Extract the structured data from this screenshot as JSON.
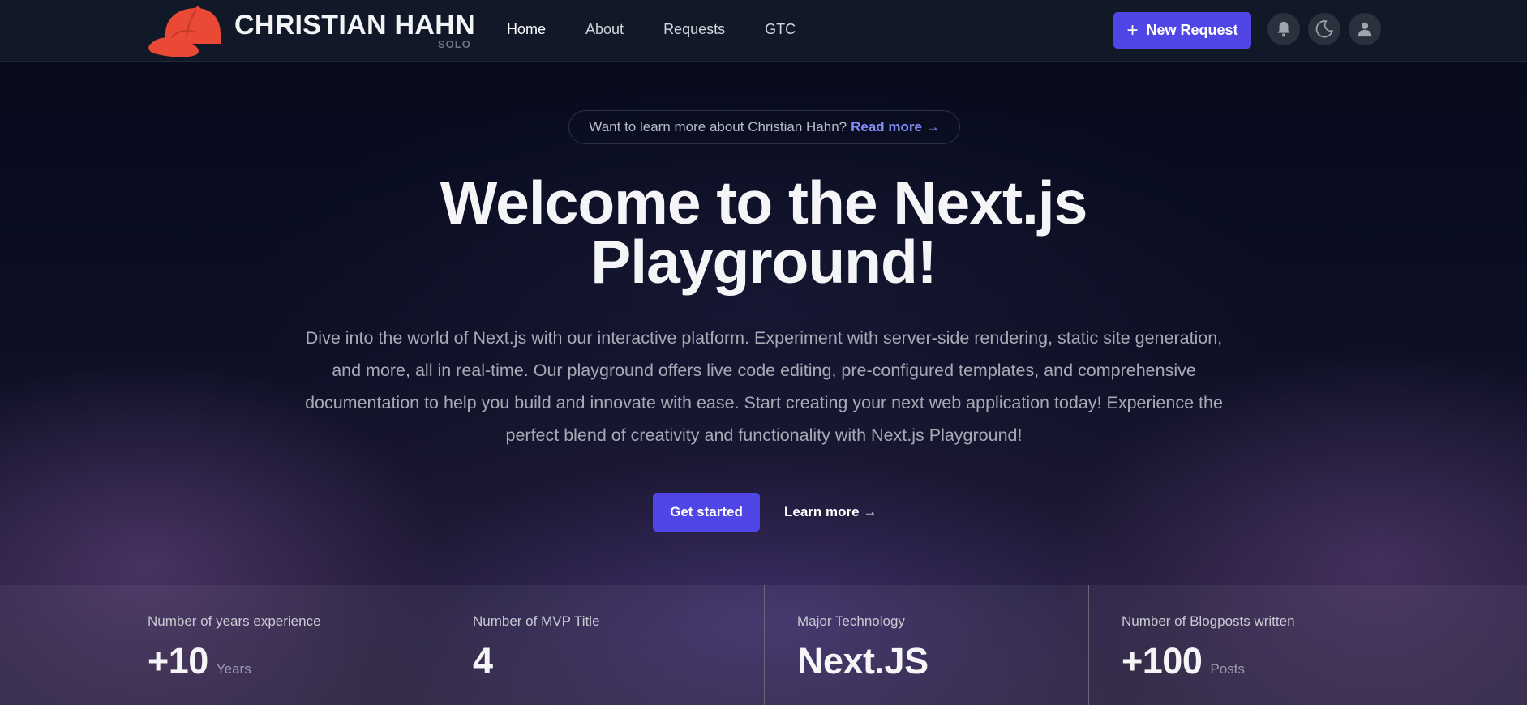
{
  "header": {
    "brand": "CHRISTIAN HAHN",
    "brand_sub": "SOLO",
    "nav": [
      "Home",
      "About",
      "Requests",
      "GTC"
    ],
    "new_request_label": "New Request",
    "icons": [
      "bell-icon",
      "moon-icon",
      "user-icon"
    ]
  },
  "hero": {
    "pill_text": "Want to learn more about Christian Hahn?",
    "pill_link": "Read more →",
    "title_line1": "Welcome to the Next.js",
    "title_line2": "Playground!",
    "description": "Dive into the world of Next.js with our interactive platform. Experiment with server-side rendering, static site generation, and more, all in real-time. Our playground offers live code editing, pre-configured templates, and comprehensive documentation to help you build and innovate with ease. Start creating your next web application today! Experience the perfect blend of creativity and functionality with Next.js Playground!",
    "primary_button": "Get started",
    "secondary_button": "Learn more →"
  },
  "stats": [
    {
      "label": "Number of years experience",
      "value": "+10",
      "unit": "Years"
    },
    {
      "label": "Number of MVP Title",
      "value": "4",
      "unit": ""
    },
    {
      "label": "Major Technology",
      "value": "Next.JS",
      "unit": ""
    },
    {
      "label": "Number of Blogposts written",
      "value": "+100",
      "unit": "Posts"
    }
  ],
  "colors": {
    "accent": "#4f46e5",
    "link": "#818cf8",
    "logo": "#ea4a35",
    "header_bg": "#111827"
  }
}
